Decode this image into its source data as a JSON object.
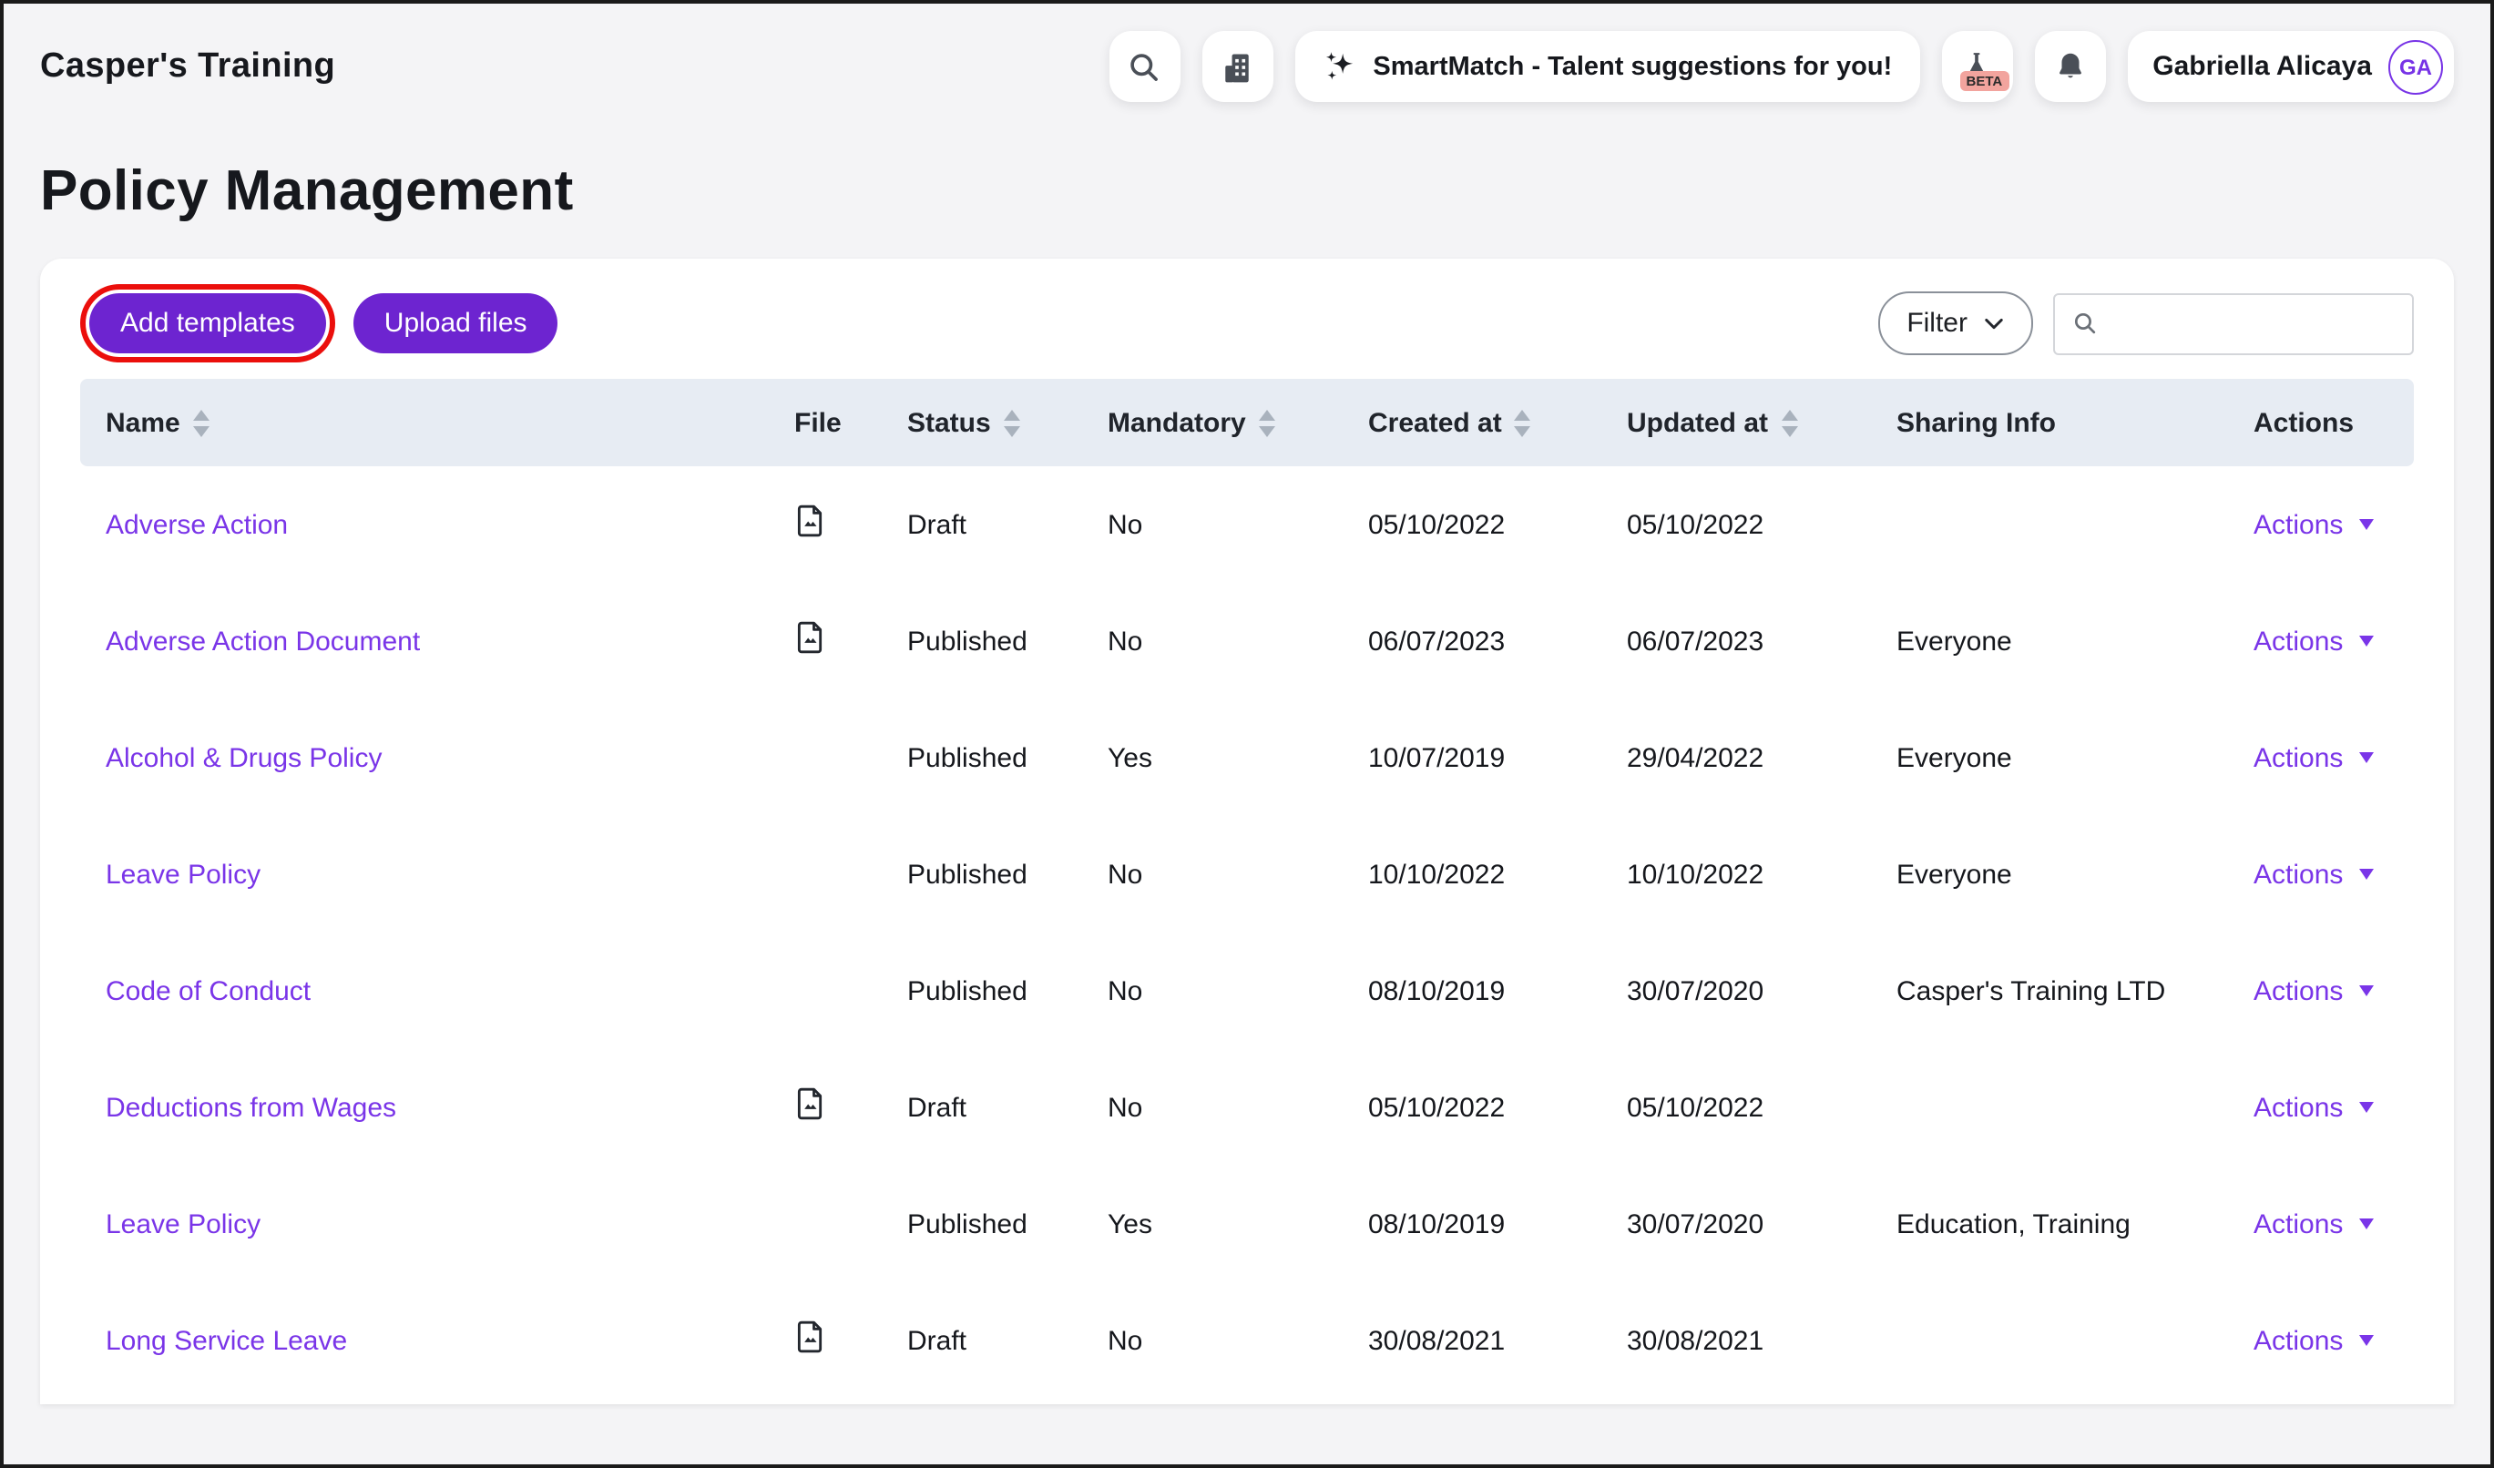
{
  "topbar": {
    "app_title": "Casper's Training",
    "smartmatch_label": "SmartMatch - Talent suggestions for you!",
    "beta_badge": "BETA",
    "user": {
      "name": "Gabriella Alicaya",
      "initials": "GA"
    }
  },
  "page": {
    "title": "Policy Management"
  },
  "toolbar": {
    "add_templates_label": "Add templates",
    "upload_files_label": "Upload files",
    "filter_label": "Filter",
    "search_value": ""
  },
  "colors": {
    "brand_purple": "#6d24d0",
    "link_purple": "#7a35e8",
    "header_row_bg": "#e7ecf3",
    "page_bg": "#f4f4f6",
    "beta_badge_bg": "#f2a49e",
    "annotation_red": "#eb0f0c"
  },
  "table": {
    "columns": [
      {
        "label": "Name",
        "sortable": true
      },
      {
        "label": "File",
        "sortable": false
      },
      {
        "label": "Status",
        "sortable": true
      },
      {
        "label": "Mandatory",
        "sortable": true
      },
      {
        "label": "Created at",
        "sortable": true
      },
      {
        "label": "Updated at",
        "sortable": true
      },
      {
        "label": "Sharing Info",
        "sortable": false
      },
      {
        "label": "Actions",
        "sortable": false
      }
    ],
    "rows": [
      {
        "name": "Adverse Action",
        "has_file": true,
        "status": "Draft",
        "mandatory": "No",
        "created_at": "05/10/2022",
        "updated_at": "05/10/2022",
        "sharing_info": "",
        "actions": "Actions"
      },
      {
        "name": "Adverse Action Document",
        "has_file": true,
        "status": "Published",
        "mandatory": "No",
        "created_at": "06/07/2023",
        "updated_at": "06/07/2023",
        "sharing_info": "Everyone",
        "actions": "Actions"
      },
      {
        "name": "Alcohol & Drugs Policy",
        "has_file": false,
        "status": "Published",
        "mandatory": "Yes",
        "created_at": "10/07/2019",
        "updated_at": "29/04/2022",
        "sharing_info": "Everyone",
        "actions": "Actions"
      },
      {
        "name": "Leave Policy",
        "has_file": false,
        "status": "Published",
        "mandatory": "No",
        "created_at": "10/10/2022",
        "updated_at": "10/10/2022",
        "sharing_info": "Everyone",
        "actions": "Actions"
      },
      {
        "name": "Code of Conduct",
        "has_file": false,
        "status": "Published",
        "mandatory": "No",
        "created_at": "08/10/2019",
        "updated_at": "30/07/2020",
        "sharing_info": "Casper's Training LTD",
        "actions": "Actions"
      },
      {
        "name": "Deductions from Wages",
        "has_file": true,
        "status": "Draft",
        "mandatory": "No",
        "created_at": "05/10/2022",
        "updated_at": "05/10/2022",
        "sharing_info": "",
        "actions": "Actions"
      },
      {
        "name": "Leave Policy",
        "has_file": false,
        "status": "Published",
        "mandatory": "Yes",
        "created_at": "08/10/2019",
        "updated_at": "30/07/2020",
        "sharing_info": "Education, Training",
        "actions": "Actions"
      },
      {
        "name": "Long Service Leave",
        "has_file": true,
        "status": "Draft",
        "mandatory": "No",
        "created_at": "30/08/2021",
        "updated_at": "30/08/2021",
        "sharing_info": "",
        "actions": "Actions"
      }
    ]
  }
}
